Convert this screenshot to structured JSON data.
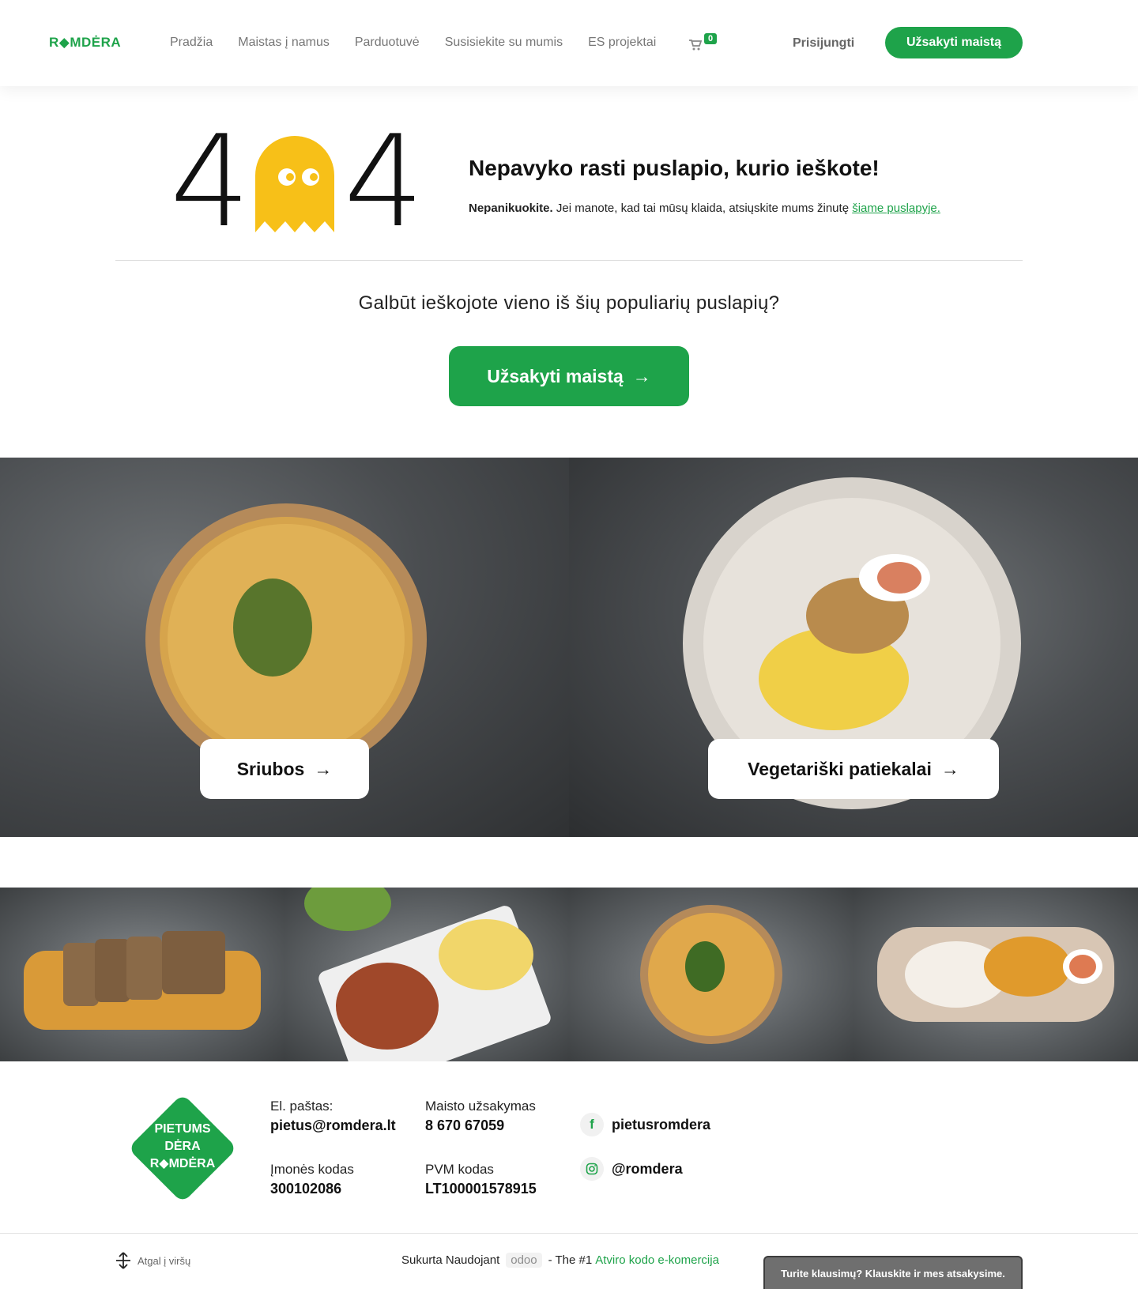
{
  "header": {
    "logo": "R◆MDĖRA",
    "nav": [
      "Pradžia",
      "Maistas į namus",
      "Parduotuvė",
      "Susisiekite su mumis",
      "ES projektai"
    ],
    "cart_count": "0",
    "login": "Prisijungti",
    "order_button": "Užsakyti maistą"
  },
  "error": {
    "digit_left": "4",
    "digit_right": "4",
    "title": "Nepavyko rasti puslapio, kurio ieškote!",
    "sub_bold": "Nepanikuokite.",
    "sub_text": " Jei manote, kad tai mūsų klaida, atsiųskite mums žinutę ",
    "sub_link": "šiame puslapyje."
  },
  "suggest": {
    "question": "Galbūt ieškojote vieno iš šių populiarių puslapių?",
    "button": "Užsakyti maistą"
  },
  "tiles": [
    {
      "label": "Sriubos"
    },
    {
      "label": "Vegetariški patiekalai"
    }
  ],
  "arrow": "→",
  "footer": {
    "logo_lines": [
      "PIETUMS",
      "DĖRA",
      "R◆MDĖRA"
    ],
    "email_label": "El. paštas:",
    "email_value": "pietus@romdera.lt",
    "company_label": "Įmonės kodas",
    "company_value": "300102086",
    "order_label": "Maisto užsakymas",
    "order_value": "8 670 67059",
    "vat_label": "PVM kodas",
    "vat_value": "LT100001578915",
    "facebook": "pietusromdera",
    "instagram": "@romdera",
    "back_to_top": "Atgal į viršų",
    "built_prefix": "Sukurta Naudojant",
    "built_brand": "odoo",
    "built_mid": "- The #1",
    "built_link": "Atviro kodo e-komercija",
    "chat": "Turite klausimų? Klauskite ir mes atsakysime."
  },
  "colors": {
    "brand_green": "#1ea34a",
    "ghost_yellow": "#f7c018"
  }
}
